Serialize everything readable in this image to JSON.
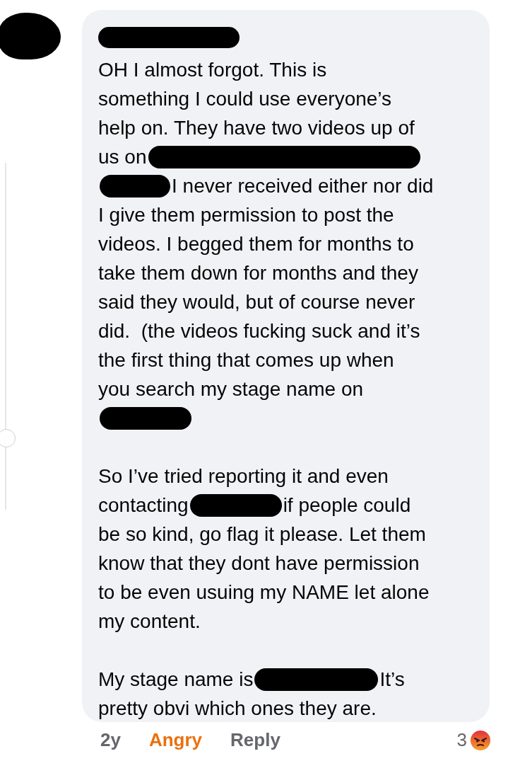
{
  "comment": {
    "author": {
      "kind": "redaction"
    },
    "paragraphs": [
      [
        [
          {
            "kind": "text",
            "text": "OH I almost forgot. This is"
          }
        ],
        [
          {
            "kind": "text",
            "text": "something I could use everyone’s"
          }
        ],
        [
          {
            "kind": "text",
            "text": "help on. They have two videos up of"
          }
        ],
        [
          {
            "kind": "text",
            "text": "us on"
          },
          {
            "kind": "redaction"
          }
        ],
        [
          {
            "kind": "redaction"
          },
          {
            "kind": "text",
            "text": "I never received either nor did"
          }
        ],
        [
          {
            "kind": "text",
            "text": "I give them permission to post the"
          }
        ],
        [
          {
            "kind": "text",
            "text": "videos. I begged them for months to"
          }
        ],
        [
          {
            "kind": "text",
            "text": "take them down for months and they"
          }
        ],
        [
          {
            "kind": "text",
            "text": "said they would, but of course never"
          }
        ],
        [
          {
            "kind": "text",
            "text": "did.  (the videos fucking suck and it’s"
          }
        ],
        [
          {
            "kind": "text",
            "text": "the first thing that comes up when"
          }
        ],
        [
          {
            "kind": "text",
            "text": "you search my stage name on"
          }
        ],
        [
          {
            "kind": "redaction"
          }
        ]
      ],
      [
        [
          {
            "kind": "text",
            "text": "So I’ve tried reporting it and even"
          }
        ],
        [
          {
            "kind": "text",
            "text": "contacting"
          },
          {
            "kind": "redaction"
          },
          {
            "kind": "text",
            "text": "if people could"
          }
        ],
        [
          {
            "kind": "text",
            "text": "be so kind, go flag it please. Let them"
          }
        ],
        [
          {
            "kind": "text",
            "text": "know that they dont have permission"
          }
        ],
        [
          {
            "kind": "text",
            "text": "to be even usuing my NAME let alone"
          }
        ],
        [
          {
            "kind": "text",
            "text": "my content."
          }
        ]
      ],
      [
        [
          {
            "kind": "text",
            "text": "My stage name is"
          },
          {
            "kind": "redaction"
          },
          {
            "kind": "text",
            "text": "It’s"
          }
        ],
        [
          {
            "kind": "text",
            "text": "pretty obvi which ones they are."
          }
        ]
      ]
    ]
  },
  "footer": {
    "time": "2y",
    "reaction_link": "Angry",
    "reply": "Reply",
    "reaction_count": "3"
  }
}
